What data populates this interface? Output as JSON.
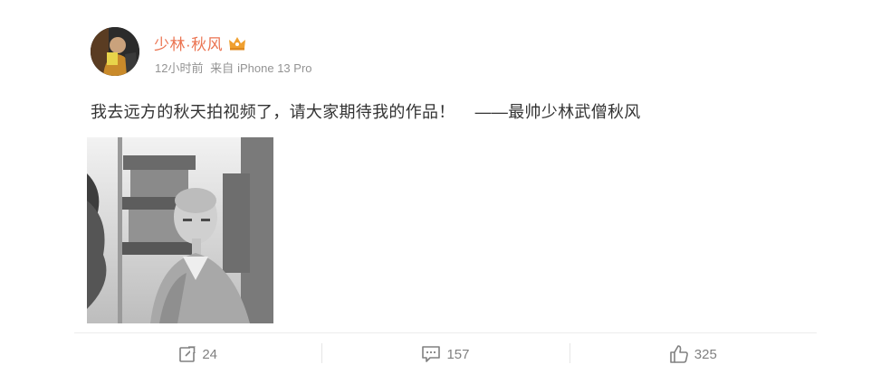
{
  "post": {
    "author": {
      "name": "少林·秋风",
      "badge_icon": "crown-icon",
      "badge_color": "#f0a030"
    },
    "time": "12小时前",
    "source_prefix": "来自",
    "device": "iPhone 13 Pro",
    "text": "我去远方的秋天拍视频了，请大家期待我的作品！",
    "signature": "——最帅少林武僧秋风"
  },
  "actions": {
    "repost": {
      "icon": "share-icon",
      "count": "24"
    },
    "comment": {
      "icon": "comment-icon",
      "count": "157"
    },
    "like": {
      "icon": "thumbs-up-icon",
      "count": "325"
    }
  },
  "colors": {
    "username": "#eb7350",
    "meta": "#939393",
    "text": "#333333",
    "action": "#808080"
  }
}
